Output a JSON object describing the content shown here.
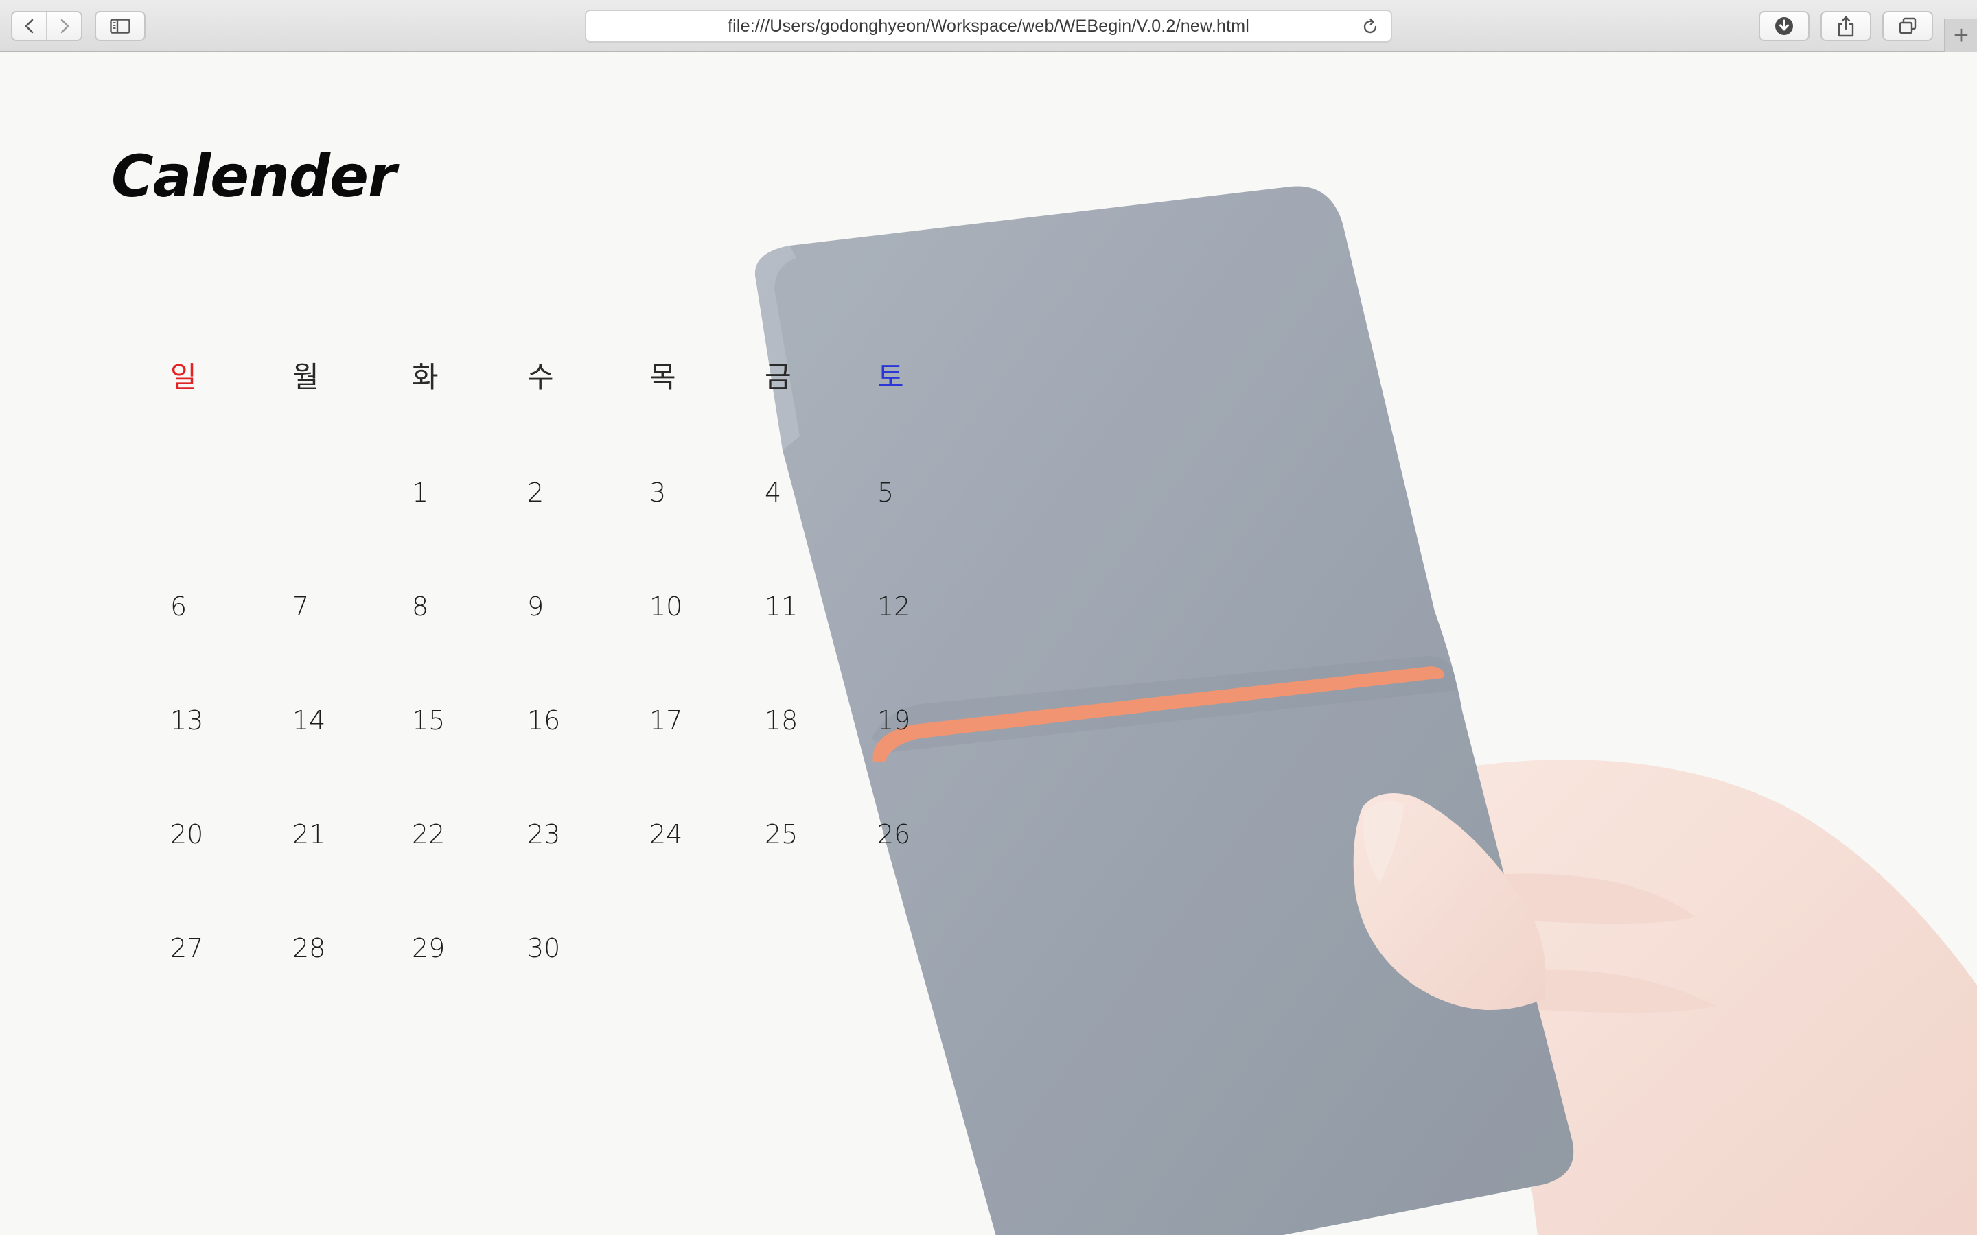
{
  "browser": {
    "address_url": "file:///Users/godonghyeon/Workspace/web/WEBegin/V.0.2/new.html",
    "new_tab_symbol": "+"
  },
  "page": {
    "title": "Calender"
  },
  "calendar": {
    "weekdays": [
      "일",
      "월",
      "화",
      "수",
      "목",
      "금",
      "토"
    ],
    "weeks": [
      [
        "",
        "",
        "1",
        "2",
        "3",
        "4",
        "5"
      ],
      [
        "6",
        "7",
        "8",
        "9",
        "10",
        "11",
        "12"
      ],
      [
        "13",
        "14",
        "15",
        "16",
        "17",
        "18",
        "19"
      ],
      [
        "20",
        "21",
        "22",
        "23",
        "24",
        "25",
        "26"
      ],
      [
        "27",
        "28",
        "29",
        "30",
        "",
        "",
        ""
      ]
    ]
  },
  "colors": {
    "sunday": "#e02424",
    "saturday": "#2b37d6",
    "notebook_cover": "#8e97a4",
    "elastic_band": "#f0865e",
    "skin": "#f5dcd2"
  },
  "icons": {
    "back": "chevron-left-icon",
    "forward": "chevron-right-icon",
    "sidebar": "sidebar-icon",
    "reload": "reload-icon",
    "downloads": "download-icon",
    "share": "share-icon",
    "tabs": "tabs-icon"
  }
}
